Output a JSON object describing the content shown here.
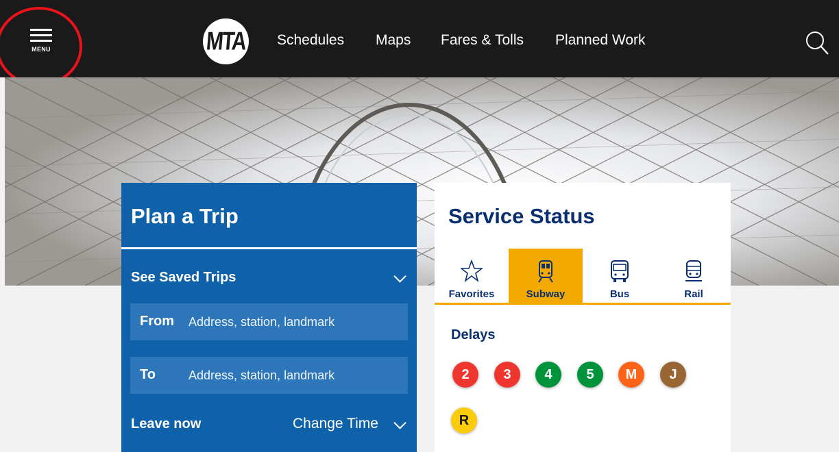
{
  "header": {
    "menu_label": "MENU",
    "logo_text": "MTA",
    "nav": [
      "Schedules",
      "Maps",
      "Fares & Tolls",
      "Planned Work"
    ]
  },
  "trip": {
    "title": "Plan a Trip",
    "saved_trips": "See Saved Trips",
    "from_label": "From",
    "from_placeholder": "Address, station, landmark",
    "to_label": "To",
    "to_placeholder": "Address, station, landmark",
    "leave_now": "Leave now",
    "change_time": "Change Time"
  },
  "status": {
    "title": "Service Status",
    "tabs": [
      "Favorites",
      "Subway",
      "Bus",
      "Rail"
    ],
    "active_tab": "Subway",
    "delays_label": "Delays",
    "delayed_lines": [
      {
        "line": "2",
        "color": "#ee352e"
      },
      {
        "line": "3",
        "color": "#ee352e"
      },
      {
        "line": "4",
        "color": "#00933c"
      },
      {
        "line": "5",
        "color": "#00933c"
      },
      {
        "line": "M",
        "color": "#ff6319"
      },
      {
        "line": "J",
        "color": "#996633"
      },
      {
        "line": "R",
        "color": "#fccc0a"
      }
    ]
  },
  "colors": {
    "header_bg": "#1a1a1a",
    "trip_bg": "#0f61a9",
    "status_title": "#0a2f70",
    "active_tab": "#f2a900",
    "annotation": "#e8141c"
  }
}
